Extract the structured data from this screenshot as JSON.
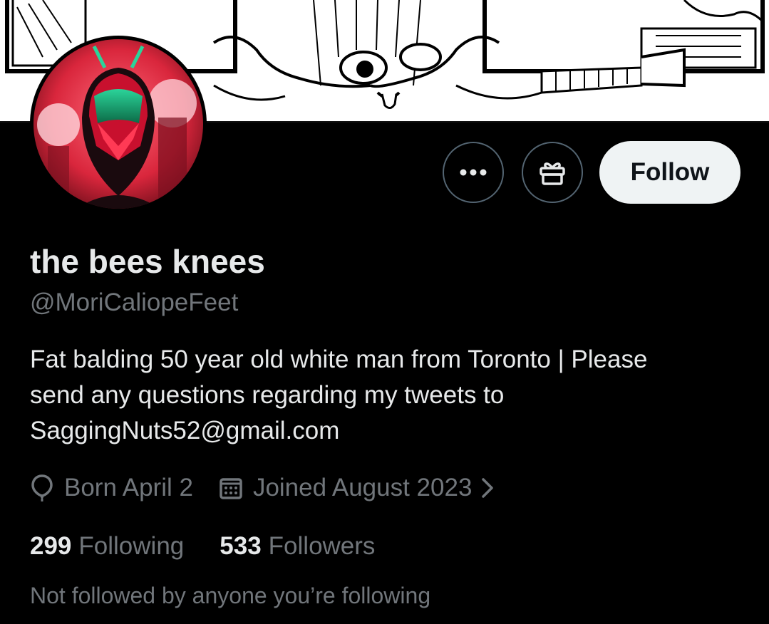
{
  "profile": {
    "display_name": "the bees knees",
    "handle": "@MoriCaliopeFeet",
    "bio_lines": [
      "Fat balding 50 year old white man from Toronto | Please",
      "send any questions regarding my tweets to",
      "SaggingNuts52@gmail.com"
    ],
    "birthday": "Born April 2",
    "joined": "Joined August 2023",
    "following_count": "299",
    "following_label": "Following",
    "followers_count": "533",
    "followers_label": "Followers",
    "mutuals_text": "Not followed by anyone you’re following"
  },
  "actions": {
    "more_icon": "more-horizontal-icon",
    "gift_icon": "gift-icon",
    "follow_label": "Follow"
  },
  "icons": {
    "birthday": "balloon-icon",
    "joined": "calendar-icon",
    "joined_chevron": "chevron-right-icon"
  },
  "colors": {
    "background": "#000000",
    "primary_text": "#e7e9ea",
    "secondary_text": "#71767b",
    "follow_button_bg": "#eff3f4",
    "outline": "#536471"
  }
}
